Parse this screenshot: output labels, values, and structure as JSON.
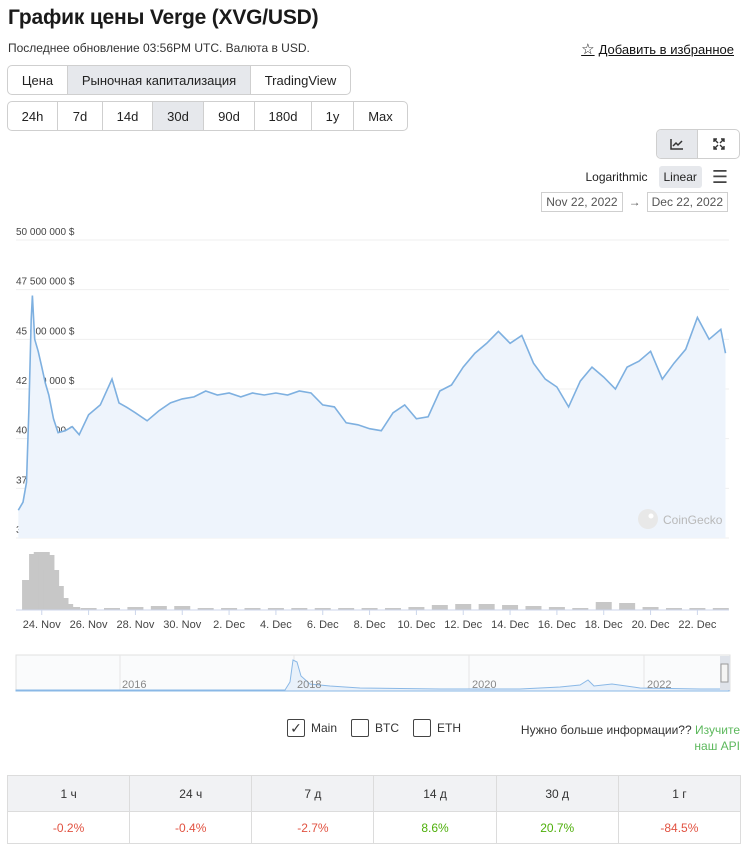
{
  "page": {
    "title": "График цены Verge (XVG/USD)",
    "subtitle": "Последнее обновление 03:56PM UTC. Валюта в USD.",
    "favorite_label": "Добавить в избранное"
  },
  "tabs": [
    {
      "label": "Цена",
      "active": false
    },
    {
      "label": "Рыночная капитализация",
      "active": true
    },
    {
      "label": "TradingView",
      "active": false
    }
  ],
  "ranges": [
    {
      "label": "24h",
      "active": false
    },
    {
      "label": "7d",
      "active": false
    },
    {
      "label": "14d",
      "active": false
    },
    {
      "label": "30d",
      "active": true
    },
    {
      "label": "90d",
      "active": false
    },
    {
      "label": "180d",
      "active": false
    },
    {
      "label": "1y",
      "active": false
    },
    {
      "label": "Max",
      "active": false
    }
  ],
  "view_buttons": {
    "line_icon": "line-chart-icon",
    "expand_icon": "expand-icon"
  },
  "scale": {
    "logarithmic": "Logarithmic",
    "linear": "Linear",
    "active": "linear",
    "menu_icon": "hamburger-icon"
  },
  "date_range": {
    "from": "Nov 22, 2022",
    "arrow": "→",
    "to": "Dec 22, 2022"
  },
  "watermark": "CoinGecko",
  "colors": {
    "line": "#7eb0e0",
    "area": "#eef4fc",
    "volume": "#c7c7c7",
    "negative": "#e15241",
    "positive": "#4eaf0a",
    "link": "#5cb85c"
  },
  "chart_data": {
    "type": "line",
    "ylim": [
      35000000,
      50000000
    ],
    "y_ticks": [
      "35 000 000 $",
      "37 500 000 $",
      "40 000 000 $",
      "42 500 000 $",
      "45 000 000 $",
      "47 500 000 $",
      "50 000 000 $"
    ],
    "y_tick_values": [
      35000000,
      37500000,
      40000000,
      42500000,
      45000000,
      47500000,
      50000000
    ],
    "xlim": [
      -0.1,
      30.35
    ],
    "x_ticks": [
      "24. Nov",
      "26. Nov",
      "28. Nov",
      "30. Nov",
      "2. Dec",
      "4. Dec",
      "6. Dec",
      "8. Dec",
      "10. Dec",
      "12. Dec",
      "14. Dec",
      "16. Dec",
      "18. Dec",
      "20. Dec",
      "22. Dec"
    ],
    "x_tick_days": [
      1,
      3,
      5,
      7,
      9,
      11,
      13,
      15,
      17,
      19,
      21,
      23,
      25,
      27,
      29
    ],
    "series": [
      {
        "x": [
          0,
          0.2,
          0.35,
          0.45,
          0.55,
          0.6,
          0.7,
          0.85,
          1,
          1.15,
          1.3,
          1.5,
          1.7,
          2,
          2.3,
          2.6,
          3,
          3.5,
          4,
          4.3,
          4.6,
          5,
          5.5,
          6,
          6.5,
          7,
          7.5,
          8,
          8.5,
          9,
          9.5,
          10,
          10.5,
          11,
          11.5,
          12,
          12.5,
          13,
          13.5,
          14,
          14.5,
          15,
          15.5,
          16,
          16.5,
          17,
          17.5,
          18,
          18.5,
          19,
          19.5,
          20,
          20.5,
          21,
          21.5,
          22,
          22.5,
          23,
          23.5,
          24,
          24.5,
          25,
          25.5,
          26,
          26.5,
          27,
          27.5,
          28,
          28.5,
          29,
          29.5,
          30,
          30.2
        ],
        "y": [
          36400000,
          36800000,
          37800000,
          41500000,
          46000000,
          47200000,
          45000000,
          44400000,
          43600000,
          42800000,
          42200000,
          41000000,
          40300000,
          40400000,
          40600000,
          40200000,
          41200000,
          41700000,
          43000000,
          41800000,
          41600000,
          41300000,
          40900000,
          41400000,
          41800000,
          42000000,
          42100000,
          42400000,
          42200000,
          42300000,
          42100000,
          42300000,
          42200000,
          42300000,
          42200000,
          42400000,
          42300000,
          41700000,
          41600000,
          40800000,
          40700000,
          40500000,
          40400000,
          41300000,
          41700000,
          41000000,
          41100000,
          42400000,
          42700000,
          43600000,
          44300000,
          44800000,
          45400000,
          44800000,
          45200000,
          43800000,
          43000000,
          42600000,
          41600000,
          42900000,
          43600000,
          43100000,
          42500000,
          43600000,
          43900000,
          44400000,
          43000000,
          43800000,
          44500000,
          46100000,
          45000000,
          45500000,
          44300000
        ]
      }
    ],
    "volume": {
      "x": [
        0.5,
        0.8,
        1.0,
        1.2,
        1.4,
        1.6,
        1.8,
        2.0,
        2.3,
        3,
        4,
        5,
        6,
        7,
        8,
        9,
        10,
        11,
        12,
        13,
        14,
        15,
        16,
        17,
        18,
        19,
        20,
        21,
        22,
        23,
        24,
        25,
        26,
        27,
        28,
        29,
        30
      ],
      "values": [
        30,
        56,
        58,
        55,
        40,
        24,
        12,
        6,
        3,
        2,
        2,
        3,
        4,
        4,
        2,
        2,
        2,
        2,
        2,
        2,
        2,
        2,
        2,
        3,
        5,
        6,
        6,
        5,
        4,
        3,
        2,
        8,
        7,
        3,
        2,
        2,
        2
      ]
    },
    "navigator": {
      "x_ticks": [
        "2016",
        "2018",
        "2020",
        "2022"
      ]
    }
  },
  "checkboxes": [
    {
      "label": "Main",
      "checked": true
    },
    {
      "label": "BTC",
      "checked": false
    },
    {
      "label": "ETH",
      "checked": false
    }
  ],
  "api_promo": {
    "text": "Нужно больше информации??",
    "link": "Изучите наш API"
  },
  "performance": {
    "headers": [
      "1 ч",
      "24 ч",
      "7 д",
      "14 д",
      "30 д",
      "1 г"
    ],
    "values": [
      "-0.2%",
      "-0.4%",
      "-2.7%",
      "8.6%",
      "20.7%",
      "-84.5%"
    ]
  }
}
